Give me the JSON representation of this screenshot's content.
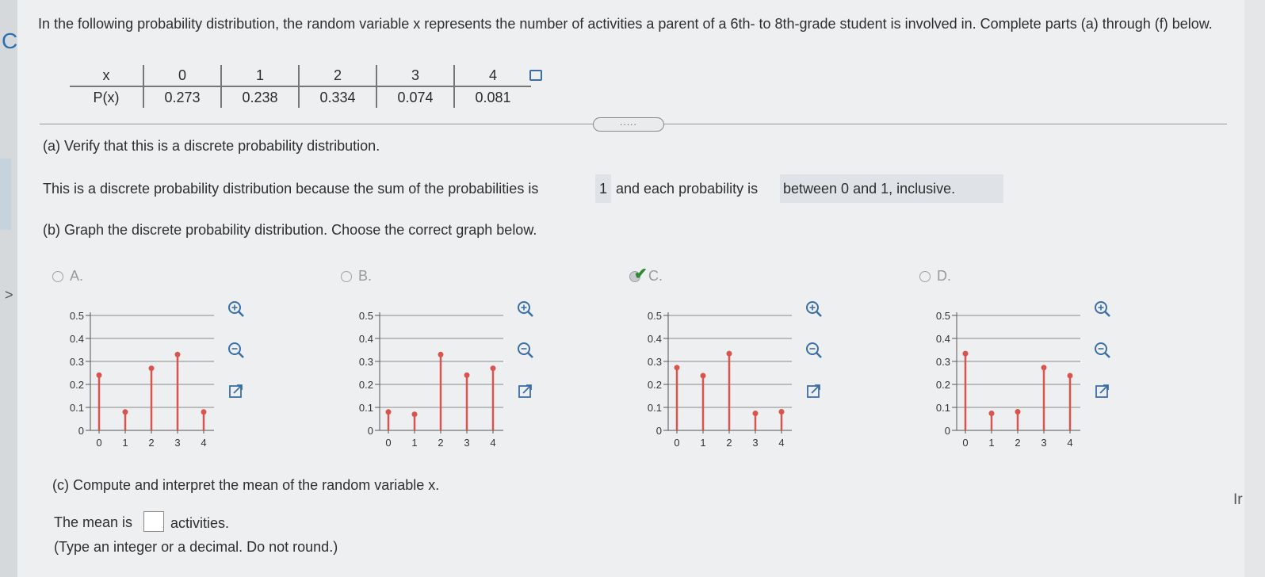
{
  "edge": {
    "left_text": "C",
    "right_text": "Ir",
    "chevron": ">"
  },
  "question": {
    "intro": "In the following probability distribution, the random variable x represents the number of activities a parent of a 6th- to 8th-grade student is involved in. Complete parts (a) through (f) below."
  },
  "table": {
    "x_label": "x",
    "p_label": "P(x)",
    "x_values": [
      "0",
      "1",
      "2",
      "3",
      "4"
    ],
    "p_values": [
      "0.273",
      "0.238",
      "0.334",
      "0.074",
      "0.081"
    ]
  },
  "divider": {
    "handle_text": "....."
  },
  "part_a": {
    "title": "(a) Verify that this is a discrete probability distribution.",
    "sentence_start": "This is a discrete probability distribution because the sum of the probabilities is",
    "sum_answer": "1",
    "sentence_mid": "and each probability is",
    "range_answer": "between 0 and 1, inclusive."
  },
  "part_b": {
    "title": "(b) Graph the discrete probability distribution. Choose the correct graph below.",
    "selected_option": "C."
  },
  "part_c": {
    "title": "(c) Compute and interpret the mean of the random variable x.",
    "mean_prefix": "The mean is",
    "mean_value": "",
    "mean_suffix": "activities.",
    "hint": "(Type an integer or a decimal. Do not round.)"
  },
  "colors": {
    "stem": "#d9534f",
    "accent": "#2f8a2f",
    "icon": "#3a6ea5"
  },
  "chart_data": [
    {
      "type": "bar",
      "option": "A.",
      "x": [
        "0",
        "1",
        "2",
        "3",
        "4"
      ],
      "values": [
        0.24,
        0.08,
        0.27,
        0.33,
        0.08
      ],
      "y_ticks": [
        "0",
        "0.1",
        "0.2",
        "0.3",
        "0.4",
        "0.5"
      ],
      "x_ticks": [
        "0",
        "1",
        "2",
        "3",
        "4"
      ],
      "ylim": [
        0,
        0.5
      ]
    },
    {
      "type": "bar",
      "option": "B.",
      "x": [
        "0",
        "1",
        "2",
        "3",
        "4"
      ],
      "values": [
        0.08,
        0.07,
        0.33,
        0.24,
        0.27
      ],
      "y_ticks": [
        "0",
        "0.1",
        "0.2",
        "0.3",
        "0.4",
        "0.5"
      ],
      "x_ticks": [
        "0",
        "1",
        "2",
        "3",
        "4"
      ],
      "ylim": [
        0,
        0.5
      ]
    },
    {
      "type": "bar",
      "option": "C.",
      "x": [
        "0",
        "1",
        "2",
        "3",
        "4"
      ],
      "values": [
        0.273,
        0.238,
        0.334,
        0.074,
        0.081
      ],
      "y_ticks": [
        "0",
        "0.1",
        "0.2",
        "0.3",
        "0.4",
        "0.5"
      ],
      "x_ticks": [
        "0",
        "1",
        "2",
        "3",
        "4"
      ],
      "ylim": [
        0,
        0.5
      ]
    },
    {
      "type": "bar",
      "option": "D.",
      "x": [
        "0",
        "1",
        "2",
        "3",
        "4"
      ],
      "values": [
        0.334,
        0.074,
        0.081,
        0.273,
        0.238
      ],
      "y_ticks": [
        "0",
        "0.1",
        "0.2",
        "0.3",
        "0.4",
        "0.5"
      ],
      "x_ticks": [
        "0",
        "1",
        "2",
        "3",
        "4"
      ],
      "ylim": [
        0,
        0.5
      ]
    }
  ]
}
